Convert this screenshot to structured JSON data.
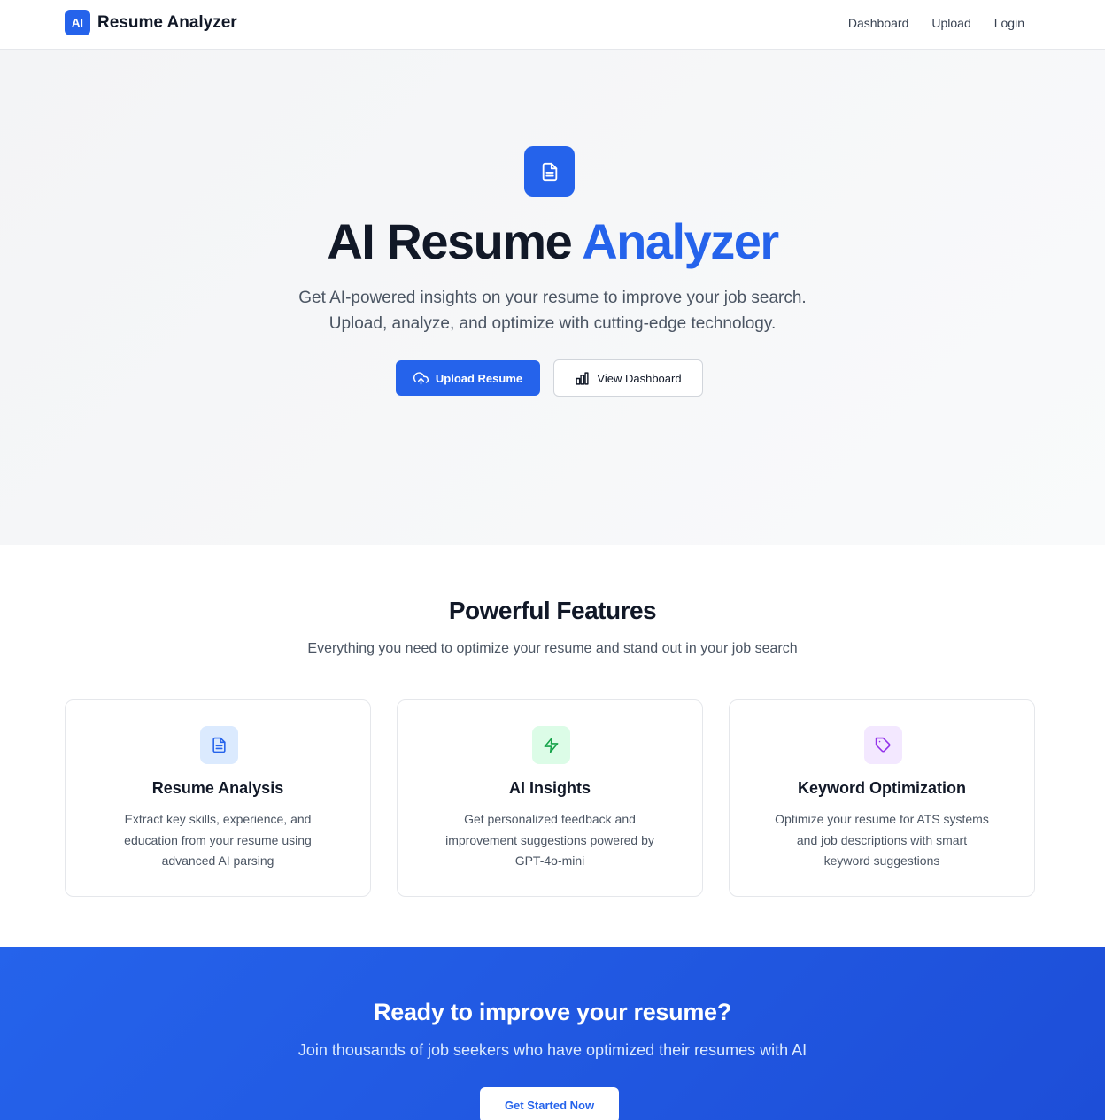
{
  "header": {
    "logo_text": "AI",
    "brand_name": "Resume Analyzer",
    "nav": [
      {
        "label": "Dashboard"
      },
      {
        "label": "Upload"
      },
      {
        "label": "Login"
      }
    ]
  },
  "hero": {
    "icon": "document-icon",
    "title_main": "AI Resume ",
    "title_accent": "Analyzer",
    "subtitle_line1": "Get AI-powered insights on your resume to improve your job search.",
    "subtitle_line2": "Upload, analyze, and optimize with cutting-edge technology.",
    "primary_button": {
      "label": "Upload Resume",
      "icon": "upload-cloud-icon"
    },
    "secondary_button": {
      "label": "View Dashboard",
      "icon": "bar-chart-icon"
    }
  },
  "features": {
    "title": "Powerful Features",
    "subtitle": "Everything you need to optimize your resume and stand out in your job search",
    "cards": [
      {
        "icon": "document-icon",
        "title": "Resume Analysis",
        "description": "Extract key skills, experience, and education from your resume using advanced AI parsing",
        "icon_color": "#2563eb",
        "icon_bg": "#dbeafe"
      },
      {
        "icon": "lightning-icon",
        "title": "AI Insights",
        "description": "Get personalized feedback and improvement suggestions powered by GPT-4o-mini",
        "icon_color": "#16a34a",
        "icon_bg": "#dcfce7"
      },
      {
        "icon": "tag-icon",
        "title": "Keyword Optimization",
        "description": "Optimize your resume for ATS systems and job descriptions with smart keyword suggestions",
        "icon_color": "#9333ea",
        "icon_bg": "#f3e8ff"
      }
    ]
  },
  "cta": {
    "title": "Ready to improve your resume?",
    "subtitle": "Join thousands of job seekers who have optimized their resumes with AI",
    "button_label": "Get Started Now"
  },
  "colors": {
    "brand": "#2563eb",
    "text_dark": "#111827",
    "text_muted": "#4b5563"
  }
}
